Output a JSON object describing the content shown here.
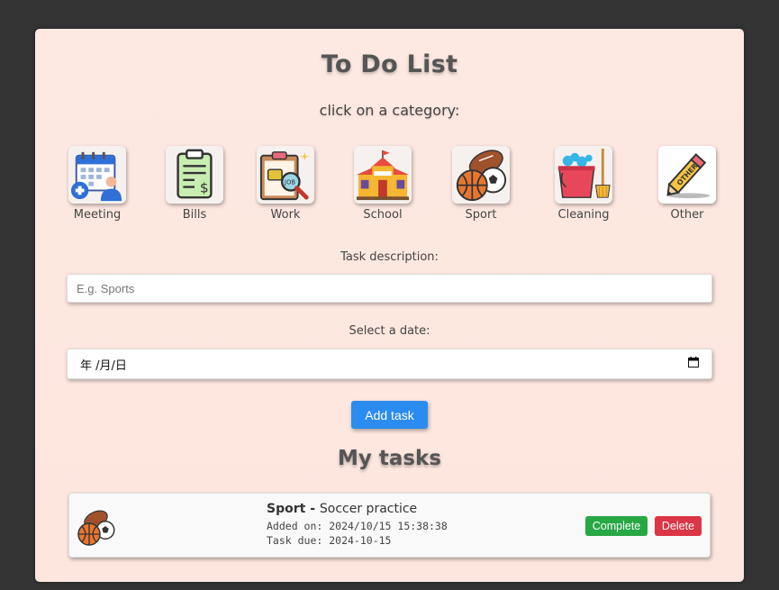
{
  "title": "To Do List",
  "subtitle": "click on a category:",
  "categories": [
    {
      "label": "Meeting",
      "icon": "meeting-calendar-icon"
    },
    {
      "label": "Bills",
      "icon": "bills-clipboard-icon"
    },
    {
      "label": "Work",
      "icon": "work-job-icon"
    },
    {
      "label": "School",
      "icon": "school-building-icon"
    },
    {
      "label": "Sport",
      "icon": "sport-balls-icon"
    },
    {
      "label": "Cleaning",
      "icon": "cleaning-bucket-icon"
    },
    {
      "label": "Other",
      "icon": "other-pencil-icon"
    }
  ],
  "task_form": {
    "description_label": "Task description:",
    "description_placeholder": "E.g. Sports",
    "date_label": "Select a date:",
    "date_display": "年 /月/日",
    "add_button": "Add task"
  },
  "tasks_heading": "My tasks",
  "tasks": [
    {
      "category": "Sport",
      "separator": " - ",
      "description": "Soccer practice",
      "added_on": "Added on: 2024/10/15 15:38:38",
      "due": "Task due: 2024-10-15",
      "complete_label": "Complete",
      "delete_label": "Delete"
    }
  ],
  "colors": {
    "background": "#333333",
    "card": "#fde9e2",
    "add_button": "#2b8cf0",
    "complete": "#28a745",
    "delete": "#dc3545"
  }
}
